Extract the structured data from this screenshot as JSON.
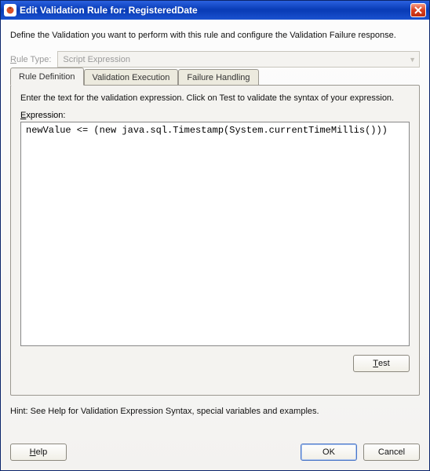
{
  "window": {
    "title": "Edit Validation Rule for: RegisteredDate"
  },
  "instructions": "Define the Validation you want to perform with this rule and configure the Validation Failure response.",
  "ruleType": {
    "label_pre": "R",
    "label_post": "ule Type:",
    "value": "Script Expression"
  },
  "tabs": {
    "definition": "Rule Definition",
    "execution": "Validation Execution",
    "failure": "Failure Handling"
  },
  "definitionTab": {
    "help": "Enter the text for the validation expression. Click on Test to validate the syntax of your expression.",
    "exprLabel_pre": "E",
    "exprLabel_post": "xpression:",
    "exprValue": "newValue <= (new java.sql.Timestamp(System.currentTimeMillis()))",
    "testLabel_pre": "T",
    "testLabel_post": "est"
  },
  "hint": "Hint: See Help for Validation Expression Syntax, special variables and examples.",
  "footer": {
    "help_pre": "H",
    "help_post": "elp",
    "ok": "OK",
    "cancel": "Cancel"
  }
}
